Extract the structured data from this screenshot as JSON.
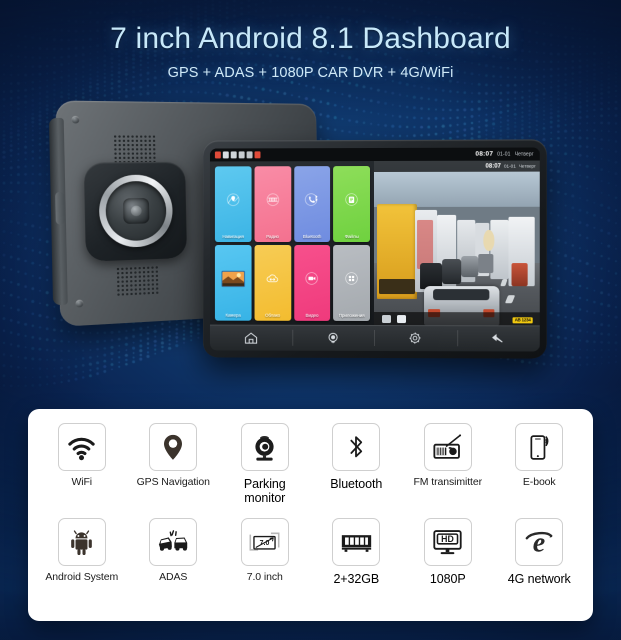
{
  "header": {
    "title": "7 inch Android 8.1 Dashboard",
    "subtitle": "GPS + ADAS + 1080P CAR DVR + 4G/WiFi",
    "title_color": "#c8e9fa",
    "background_color": "#0a2350"
  },
  "device": {
    "status_bar": {
      "time": "08:07",
      "date": "01-01",
      "weekday": "Четверг"
    },
    "launcher_apps": [
      {
        "label": "Навигация",
        "icon": "navigation-pin-icon",
        "color": "#5ec9f0",
        "color2": "#3bb4e5"
      },
      {
        "label": "Радио",
        "icon": "radio-dial-icon",
        "color": "#f98ca6",
        "color2": "#f4718f"
      },
      {
        "label": "Bluetooth",
        "icon": "phone-bluetooth-icon",
        "color": "#8aa4e8",
        "color2": "#6f8ce0"
      },
      {
        "label": "Файлы",
        "icon": "files-folder-icon",
        "color": "#8ede5a",
        "color2": "#6fd13f"
      },
      {
        "label": "Камера",
        "icon": "camera-photo-icon",
        "color": "#58c7f2",
        "color2": "#37b3e6"
      },
      {
        "label": "Облако",
        "icon": "cloud-icon",
        "color": "#f7cc55",
        "color2": "#f3bc2f"
      },
      {
        "label": "Видео",
        "icon": "video-camera-icon",
        "color": "#f7508c",
        "color2": "#ef3a7c"
      },
      {
        "label": "Приложения",
        "icon": "apps-grid-icon",
        "color": "#b9bdc2",
        "color2": "#a4a9ae"
      }
    ],
    "nav_buttons": [
      {
        "name": "home-icon"
      },
      {
        "name": "camera-icon"
      },
      {
        "name": "settings-gear-icon"
      },
      {
        "name": "back-arrow-icon"
      }
    ],
    "dashcam": {
      "time": "08:07",
      "date": "01-01",
      "weekday": "Четверг",
      "plate": "AB 1234"
    }
  },
  "features": {
    "row1": [
      {
        "label": "WiFi",
        "icon": "wifi-icon"
      },
      {
        "label": "GPS Navigation",
        "icon": "map-pin-icon"
      },
      {
        "label": "Parking\nmonitor",
        "icon": "webcam-icon"
      },
      {
        "label": "Bluetooth",
        "icon": "bluetooth-icon"
      },
      {
        "label": "FM transimitter",
        "icon": "radio-icon"
      },
      {
        "label": "E-book",
        "icon": "smartphone-signal-icon"
      }
    ],
    "row2": [
      {
        "label": "Android System",
        "icon": "android-robot-icon"
      },
      {
        "label": "ADAS",
        "icon": "car-collision-icon"
      },
      {
        "label": "7.0 inch",
        "icon": "screen-size-icon",
        "inner_text": "7.0"
      },
      {
        "label": "2+32GB",
        "icon": "memory-ram-icon"
      },
      {
        "label": "1080P",
        "icon": "hd-monitor-icon",
        "inner_text": "HD"
      },
      {
        "label": "4G network",
        "icon": "internet-explorer-e-icon"
      }
    ]
  }
}
